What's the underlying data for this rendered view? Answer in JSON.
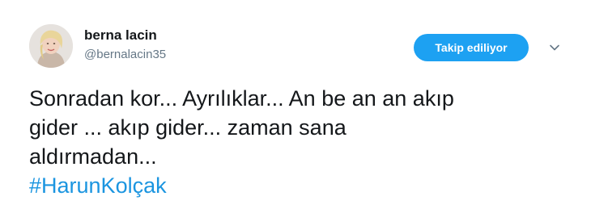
{
  "user": {
    "display_name": "berna lacin",
    "handle": "@bernalacin35",
    "avatar_icon": "profile-photo"
  },
  "actions": {
    "follow_label": "Takip ediliyor",
    "more_icon": "chevron-down-icon"
  },
  "tweet": {
    "lines": [
      "Sonradan kor... Ayrılıklar... An be an an akıp",
      "gider ... akıp gider... zaman sana",
      "aldırmadan..."
    ],
    "hashtag": "#HarunKolçak"
  },
  "colors": {
    "accent": "#1da1f2",
    "link": "#1b95e0",
    "text": "#14171a",
    "muted": "#657786"
  }
}
